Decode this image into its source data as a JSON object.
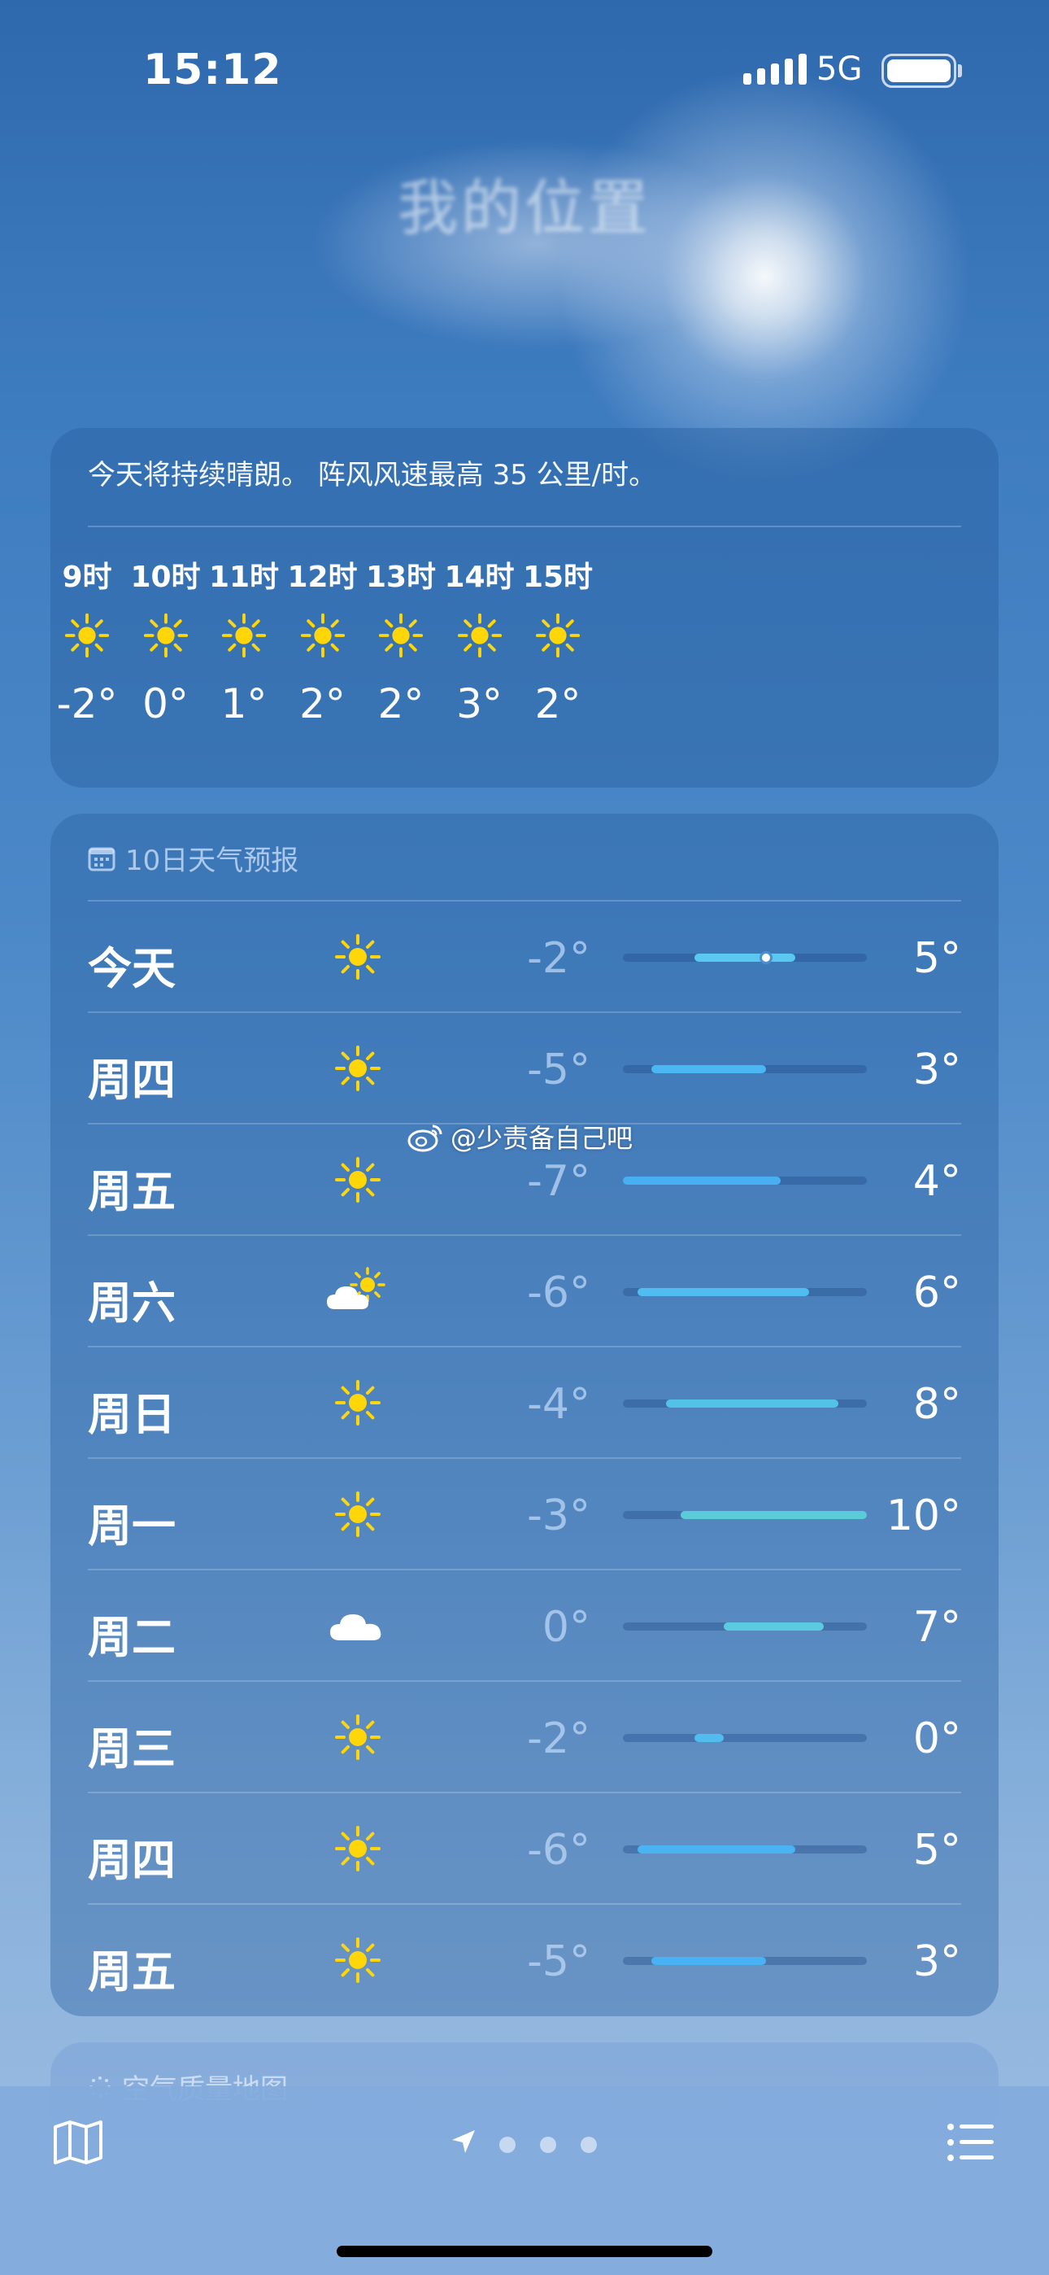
{
  "status_bar": {
    "time": "15:12",
    "network": "5G"
  },
  "location_title": "我的位置",
  "hourly": {
    "summary": "今天将持续晴朗。 阵风风速最高 35 公里/时。",
    "hours": [
      {
        "label": "9时",
        "icon": "sun-icon",
        "temp": "-2°"
      },
      {
        "label": "10时",
        "icon": "sun-icon",
        "temp": "0°"
      },
      {
        "label": "11时",
        "icon": "sun-icon",
        "temp": "1°"
      },
      {
        "label": "12时",
        "icon": "sun-icon",
        "temp": "2°"
      },
      {
        "label": "13时",
        "icon": "sun-icon",
        "temp": "2°"
      },
      {
        "label": "14时",
        "icon": "sun-icon",
        "temp": "3°"
      },
      {
        "label": "15时",
        "icon": "sun-icon",
        "temp": "2°"
      }
    ]
  },
  "ten_day": {
    "title": "10日天气预报",
    "range_min": -7,
    "range_max": 10,
    "days": [
      {
        "name": "今天",
        "icon": "sun-icon",
        "low": "-2°",
        "high": "5°",
        "low_val": -2,
        "high_val": 5,
        "current_val": 3,
        "bar_color": "#5ac8f0"
      },
      {
        "name": "周四",
        "icon": "sun-icon",
        "low": "-5°",
        "high": "3°",
        "low_val": -5,
        "high_val": 3,
        "bar_color": "#4ab6f2"
      },
      {
        "name": "周五",
        "icon": "sun-icon",
        "low": "-7°",
        "high": "4°",
        "low_val": -7,
        "high_val": 4,
        "bar_color": "#48b0f2"
      },
      {
        "name": "周六",
        "icon": "partly-cloudy-icon",
        "low": "-6°",
        "high": "6°",
        "low_val": -6,
        "high_val": 6,
        "bar_color": "#50bcef"
      },
      {
        "name": "周日",
        "icon": "sun-icon",
        "low": "-4°",
        "high": "8°",
        "low_val": -4,
        "high_val": 8,
        "bar_color": "#52c2e6"
      },
      {
        "name": "周一",
        "icon": "sun-icon",
        "low": "-3°",
        "high": "10°",
        "low_val": -3,
        "high_val": 10,
        "bar_color": "#5ccbd8"
      },
      {
        "name": "周二",
        "icon": "cloud-icon",
        "low": "0°",
        "high": "7°",
        "low_val": 0,
        "high_val": 7,
        "bar_color": "#5ccbe0"
      },
      {
        "name": "周三",
        "icon": "sun-icon",
        "low": "-2°",
        "high": "0°",
        "low_val": -2,
        "high_val": 0,
        "bar_color": "#52bcef"
      },
      {
        "name": "周四",
        "icon": "sun-icon",
        "low": "-6°",
        "high": "5°",
        "low_val": -6,
        "high_val": 5,
        "bar_color": "#4ab4f2"
      },
      {
        "name": "周五",
        "icon": "sun-icon",
        "low": "-5°",
        "high": "3°",
        "low_val": -5,
        "high_val": 3,
        "bar_color": "#48b2f2"
      }
    ]
  },
  "watermark": "@少责备自己吧",
  "aqi_card": {
    "title": "空气质量地图"
  },
  "bottom_bar": {
    "page_count": 3
  }
}
